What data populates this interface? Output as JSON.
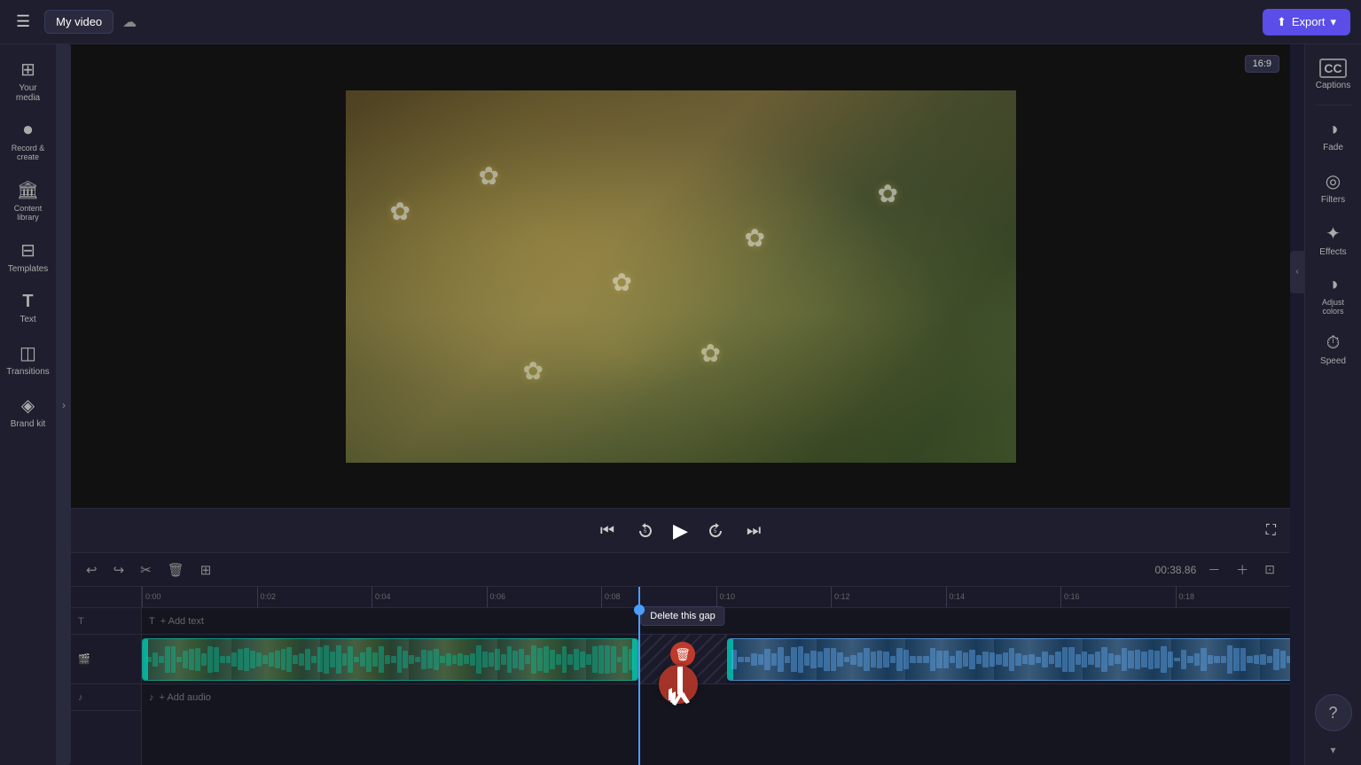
{
  "topbar": {
    "menu_label": "☰",
    "project_name": "My video",
    "cloud_icon": "☁",
    "export_label": "Export",
    "export_chevron": "▾",
    "captions_label": "Captions"
  },
  "left_sidebar": {
    "items": [
      {
        "id": "your-media",
        "icon": "⊞",
        "label": "Your media"
      },
      {
        "id": "record-create",
        "icon": "⏺",
        "label": "Record &\ncreate"
      },
      {
        "id": "content-library",
        "icon": "🏛",
        "label": "Content\nlibrary"
      },
      {
        "id": "templates",
        "icon": "⊟",
        "label": "Templates"
      },
      {
        "id": "text",
        "icon": "T",
        "label": "Text"
      },
      {
        "id": "transitions",
        "icon": "◫",
        "label": "Transitions"
      },
      {
        "id": "brand-kit",
        "icon": "◈",
        "label": "Brand kit"
      }
    ],
    "collapse_icon": "›"
  },
  "right_sidebar": {
    "items": [
      {
        "id": "captions",
        "icon": "CC",
        "label": "Captions"
      },
      {
        "id": "fade",
        "icon": "◑",
        "label": "Fade"
      },
      {
        "id": "filters",
        "icon": "◎",
        "label": "Filters"
      },
      {
        "id": "effects",
        "icon": "✦",
        "label": "Effects"
      },
      {
        "id": "adjust-colors",
        "icon": "◑",
        "label": "Adjust\ncolors"
      },
      {
        "id": "speed",
        "icon": "⏱",
        "label": "Speed"
      }
    ],
    "collapse_icon": "‹"
  },
  "video_preview": {
    "aspect_ratio": "16:9"
  },
  "playback": {
    "skip_back": "⏮",
    "rewind": "↺",
    "play": "▶",
    "forward": "↻",
    "skip_forward": "⏭",
    "fullscreen": "⛶"
  },
  "timeline": {
    "undo": "↩",
    "redo": "↪",
    "cut": "✂",
    "delete": "🗑",
    "add_clip": "⊞",
    "time": "00:38.86",
    "zoom_out": "－",
    "zoom_in": "＋",
    "fit": "⊞",
    "rulers": [
      "0:00",
      "0:02",
      "0:04",
      "0:06",
      "0:08",
      "0:10",
      "0:12",
      "0:14",
      "0:16",
      "0:18"
    ],
    "text_track_label": "+ Add text",
    "text_icon": "T",
    "audio_track_label": "+ Add audio",
    "audio_icon": "♪",
    "delete_gap_tooltip": "Delete this gap"
  },
  "help": {
    "label": "?"
  }
}
